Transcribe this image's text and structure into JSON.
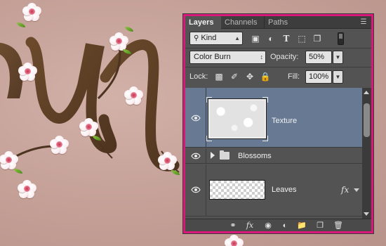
{
  "tabs": [
    {
      "label": "Layers"
    },
    {
      "label": "Channels"
    },
    {
      "label": "Paths"
    }
  ],
  "filter": {
    "kind_label": "Kind"
  },
  "blend": {
    "mode": "Color Burn",
    "opacity_label": "Opacity:",
    "opacity_value": "50%"
  },
  "lock": {
    "label": "Lock:",
    "fill_label": "Fill:",
    "fill_value": "100%"
  },
  "layers": [
    {
      "name": "Texture",
      "selected": true,
      "visible": true
    },
    {
      "name": "Blossoms",
      "type": "group",
      "visible": true
    },
    {
      "name": "Leaves",
      "visible": true
    }
  ],
  "colors": {
    "highlight_border": "#d9197a",
    "panel_bg": "#535353",
    "selected_row": "#677993"
  }
}
